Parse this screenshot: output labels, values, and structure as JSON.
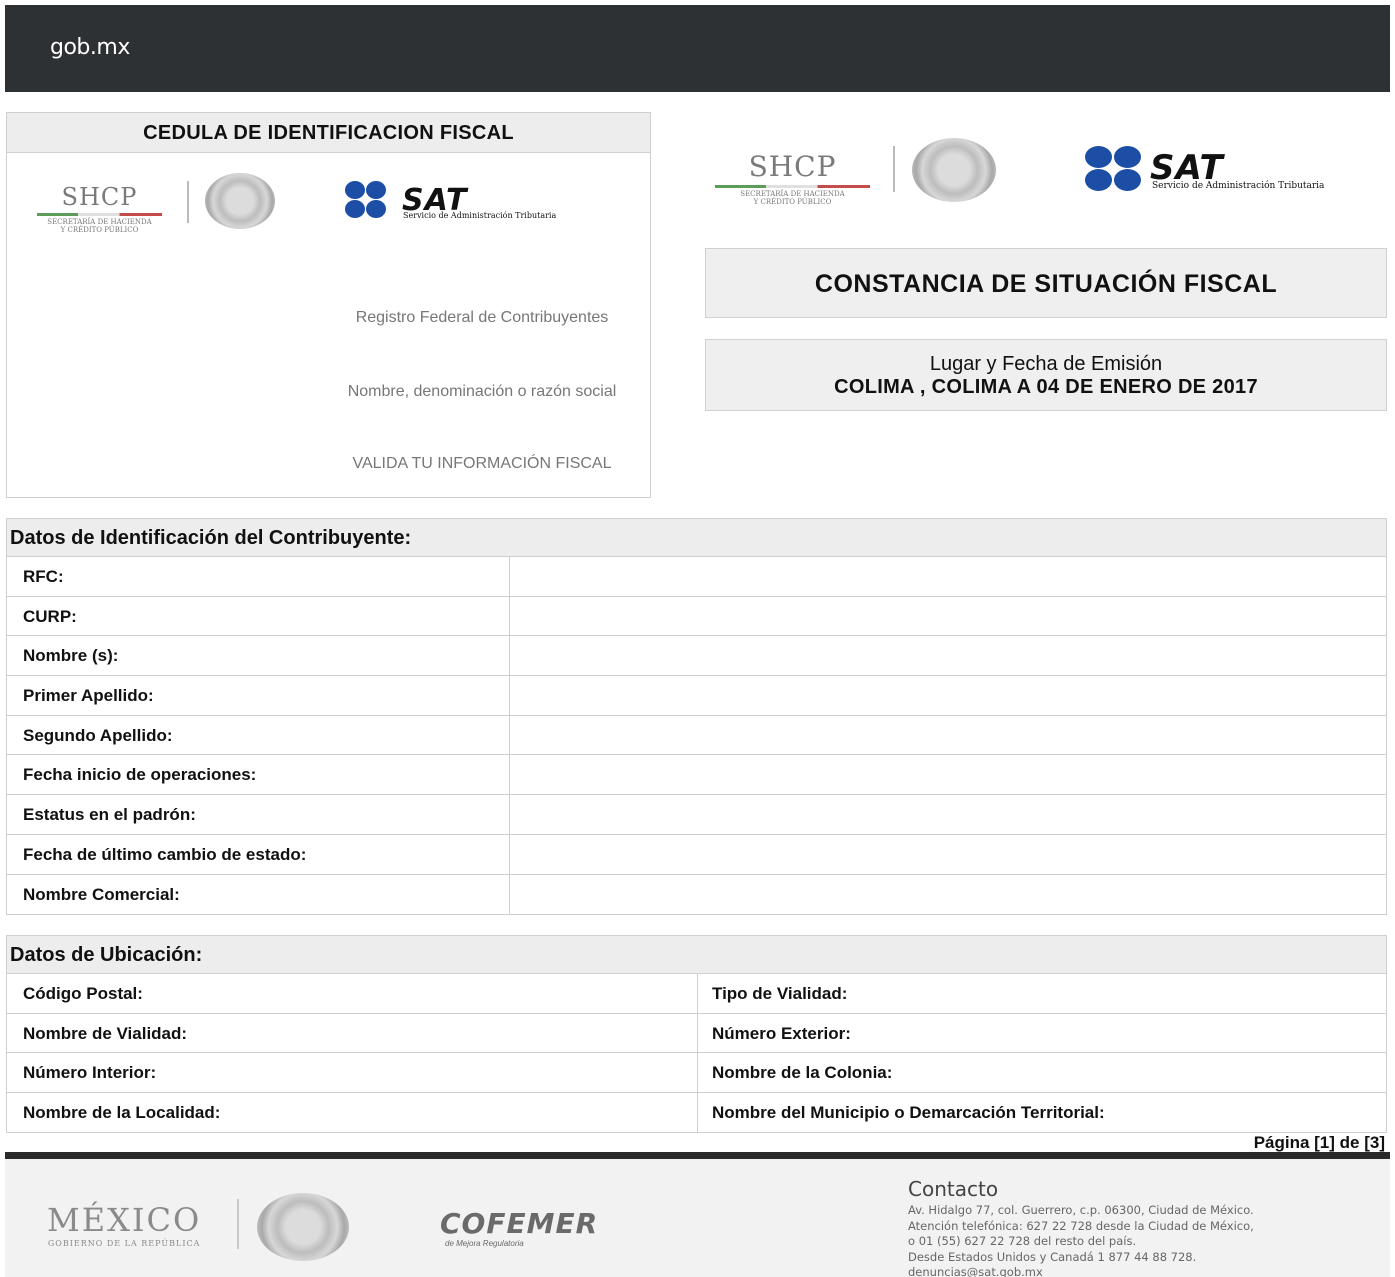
{
  "header": {
    "brand": "gob.mx"
  },
  "cedula": {
    "title": "CEDULA DE IDENTIFICACION FISCAL",
    "registro": "Registro Federal de Contribuyentes",
    "nombre_label": "Nombre, denominación o razón social",
    "valida": "VALIDA TU INFORMACIÓN FISCAL"
  },
  "logos": {
    "shcp": "SHCP",
    "shcp_sub1": "SECRETARÍA DE HACIENDA",
    "shcp_sub2": "Y CRÉDITO PÚBLICO",
    "sat": "SAT",
    "sat_sub": "Servicio de Administración Tributaria"
  },
  "constancia": {
    "title": "CONSTANCIA DE SITUACIÓN FISCAL",
    "lugar_label": "Lugar y Fecha de Emisión",
    "lugar_value": "COLIMA , COLIMA A 04 DE ENERO DE 2017"
  },
  "identificacion": {
    "title": "Datos de Identificación del Contribuyente:",
    "rows": [
      {
        "label": "RFC:",
        "value": ""
      },
      {
        "label": "CURP:",
        "value": ""
      },
      {
        "label": "Nombre (s):",
        "value": ""
      },
      {
        "label": "Primer Apellido:",
        "value": ""
      },
      {
        "label": "Segundo Apellido:",
        "value": ""
      },
      {
        "label": "Fecha inicio de operaciones:",
        "value": ""
      },
      {
        "label": "Estatus en el padrón:",
        "value": ""
      },
      {
        "label": "Fecha de último cambio de estado:",
        "value": ""
      },
      {
        "label": "Nombre Comercial:",
        "value": ""
      }
    ]
  },
  "ubicacion": {
    "title": "Datos de Ubicación:",
    "rows": [
      {
        "left": "Código Postal:",
        "right": "Tipo de Vialidad:"
      },
      {
        "left": "Nombre de Vialidad:",
        "right": "Número Exterior:"
      },
      {
        "left": "Número Interior:",
        "right": "Nombre de la Colonia:"
      },
      {
        "left": "Nombre de la Localidad:",
        "right": "Nombre del Municipio o Demarcación Territorial:"
      }
    ]
  },
  "pagina": "Página  [1] de [3]",
  "footer": {
    "mexico": "MÉXICO",
    "mexico_sub": "GOBIERNO DE LA REPÚBLICA",
    "cofemer": "COFEMER",
    "cofemer_sub": "de Mejora Regulatoria",
    "contacto_title": "Contacto",
    "contacto_lines": [
      "Av. Hidalgo 77, col. Guerrero, c.p. 06300, Ciudad de México.",
      "Atención telefónica: 627 22 728 desde la Ciudad de México,",
      "o 01 (55) 627 22 728 del resto del país.",
      "Desde Estados Unidos y Canadá 1 877 44 88 728.",
      "denuncias@sat.gob.mx"
    ]
  }
}
